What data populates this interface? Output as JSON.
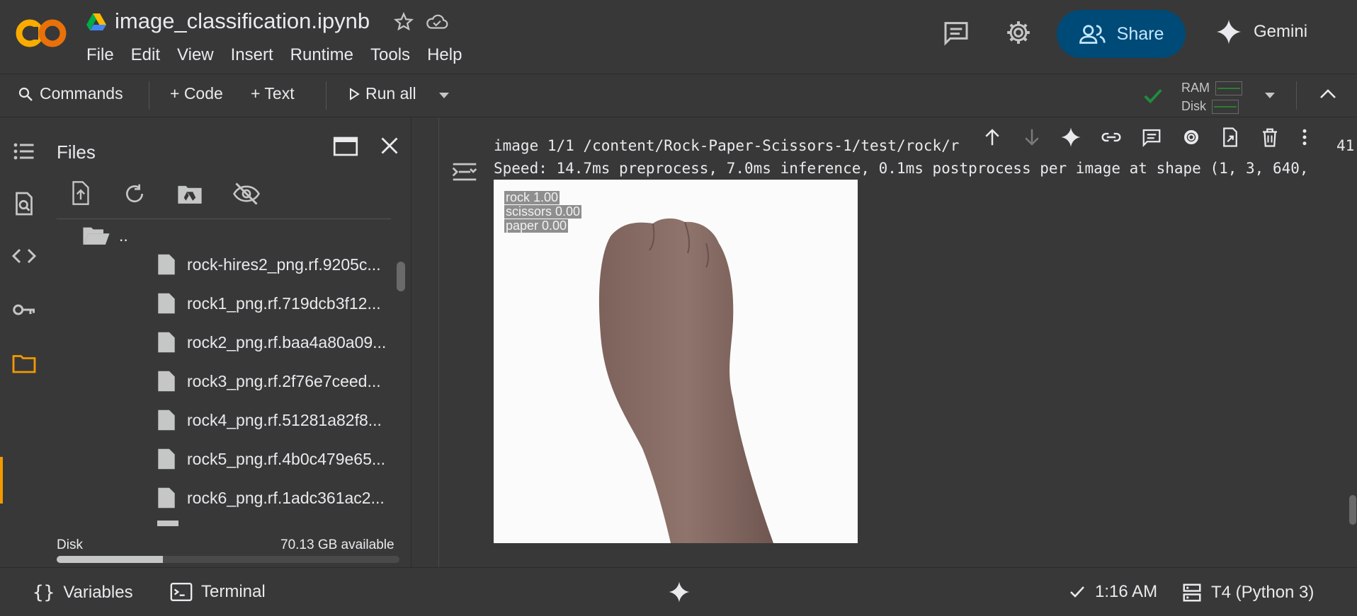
{
  "header": {
    "doc_title": "image_classification.ipynb",
    "menu": [
      "File",
      "Edit",
      "View",
      "Insert",
      "Runtime",
      "Tools",
      "Help"
    ],
    "share_label": "Share",
    "gemini_label": "Gemini"
  },
  "toolbar": {
    "commands_label": "Commands",
    "code_label": "+ Code",
    "text_label": "+ Text",
    "run_all_label": "Run all",
    "ram_label": "RAM",
    "disk_label": "Disk"
  },
  "files_panel": {
    "title": "Files",
    "parent_folder": "..",
    "files": [
      "rock-hires2_png.rf.9205c...",
      "rock1_png.rf.719dcb3f12...",
      "rock2_png.rf.baa4a80a09...",
      "rock3_png.rf.2f76e7ceed...",
      "rock4_png.rf.51281a82f8...",
      "rock5_png.rf.4b0c479e65...",
      "rock6_png.rf.1adc361ac2..."
    ],
    "disk_label": "Disk",
    "disk_available": "70.13 GB available",
    "disk_used_fraction": 0.31
  },
  "output": {
    "line1": "image 1/1 /content/Rock-Paper-Scissors-1/test/rock/r",
    "line1_tail": "41",
    "line2": "Speed: 14.7ms preprocess, 7.0ms inference, 0.1ms postprocess per image at shape (1, 3, 640,",
    "labels": [
      "rock 1.00",
      "scissors 0.00",
      "paper 0.00"
    ]
  },
  "status": {
    "variables_label": "Variables",
    "terminal_label": "Terminal",
    "time": "1:16 AM",
    "runtime": "T4 (Python 3)"
  },
  "colors": {
    "background": "#383838",
    "share_button": "#004a77",
    "accent_orange": "#f29900",
    "check_green": "#1e8e3e"
  }
}
